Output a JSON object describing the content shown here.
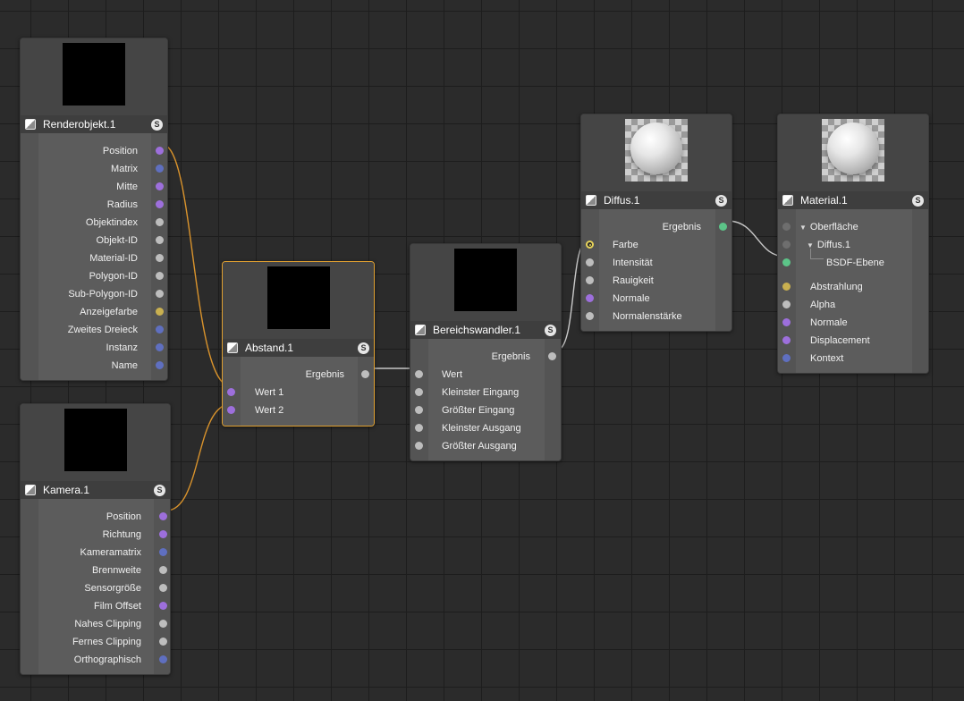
{
  "nodes": {
    "render": {
      "title": "Renderobjekt.1",
      "s_label": "S",
      "outputs": [
        "Position",
        "Matrix",
        "Mitte",
        "Radius",
        "Objektindex",
        "Objekt-ID",
        "Material-ID",
        "Polygon-ID",
        "Sub-Polygon-ID",
        "Anzeigefarbe",
        "Zweites Dreieck",
        "Instanz",
        "Name"
      ]
    },
    "kamera": {
      "title": "Kamera.1",
      "s_label": "S",
      "outputs": [
        "Position",
        "Richtung",
        "Kameramatrix",
        "Brennweite",
        "Sensorgröße",
        "Film Offset",
        "Nahes Clipping",
        "Fernes Clipping",
        "Orthographisch"
      ]
    },
    "abstand": {
      "title": "Abstand.1",
      "s_label": "S",
      "output": "Ergebnis",
      "inputs": [
        "Wert 1",
        "Wert 2"
      ]
    },
    "bereich": {
      "title": "Bereichswandler.1",
      "s_label": "S",
      "output": "Ergebnis",
      "inputs": [
        "Wert",
        "Kleinster Eingang",
        "Größter Eingang",
        "Kleinster Ausgang",
        "Größter Ausgang"
      ]
    },
    "diffus": {
      "title": "Diffus.1",
      "s_label": "S",
      "output": "Ergebnis",
      "inputs": [
        "Farbe",
        "Intensität",
        "Rauigkeit",
        "Normale",
        "Normalenstärke"
      ]
    },
    "material": {
      "title": "Material.1",
      "s_label": "S",
      "tree": [
        "Oberfläche",
        "Diffus.1",
        "BSDF-Ebene"
      ],
      "inputs": [
        "Abstrahlung",
        "Alpha",
        "Normale",
        "Displacement",
        "Kontext"
      ]
    }
  },
  "colors": {
    "wire_orange": "#d9932c",
    "wire_grey": "#c8c8c8",
    "selection": "#e0a030",
    "port_purple": "#9d6fdc",
    "port_blue": "#5f6fc0",
    "port_green": "#5cc488"
  }
}
